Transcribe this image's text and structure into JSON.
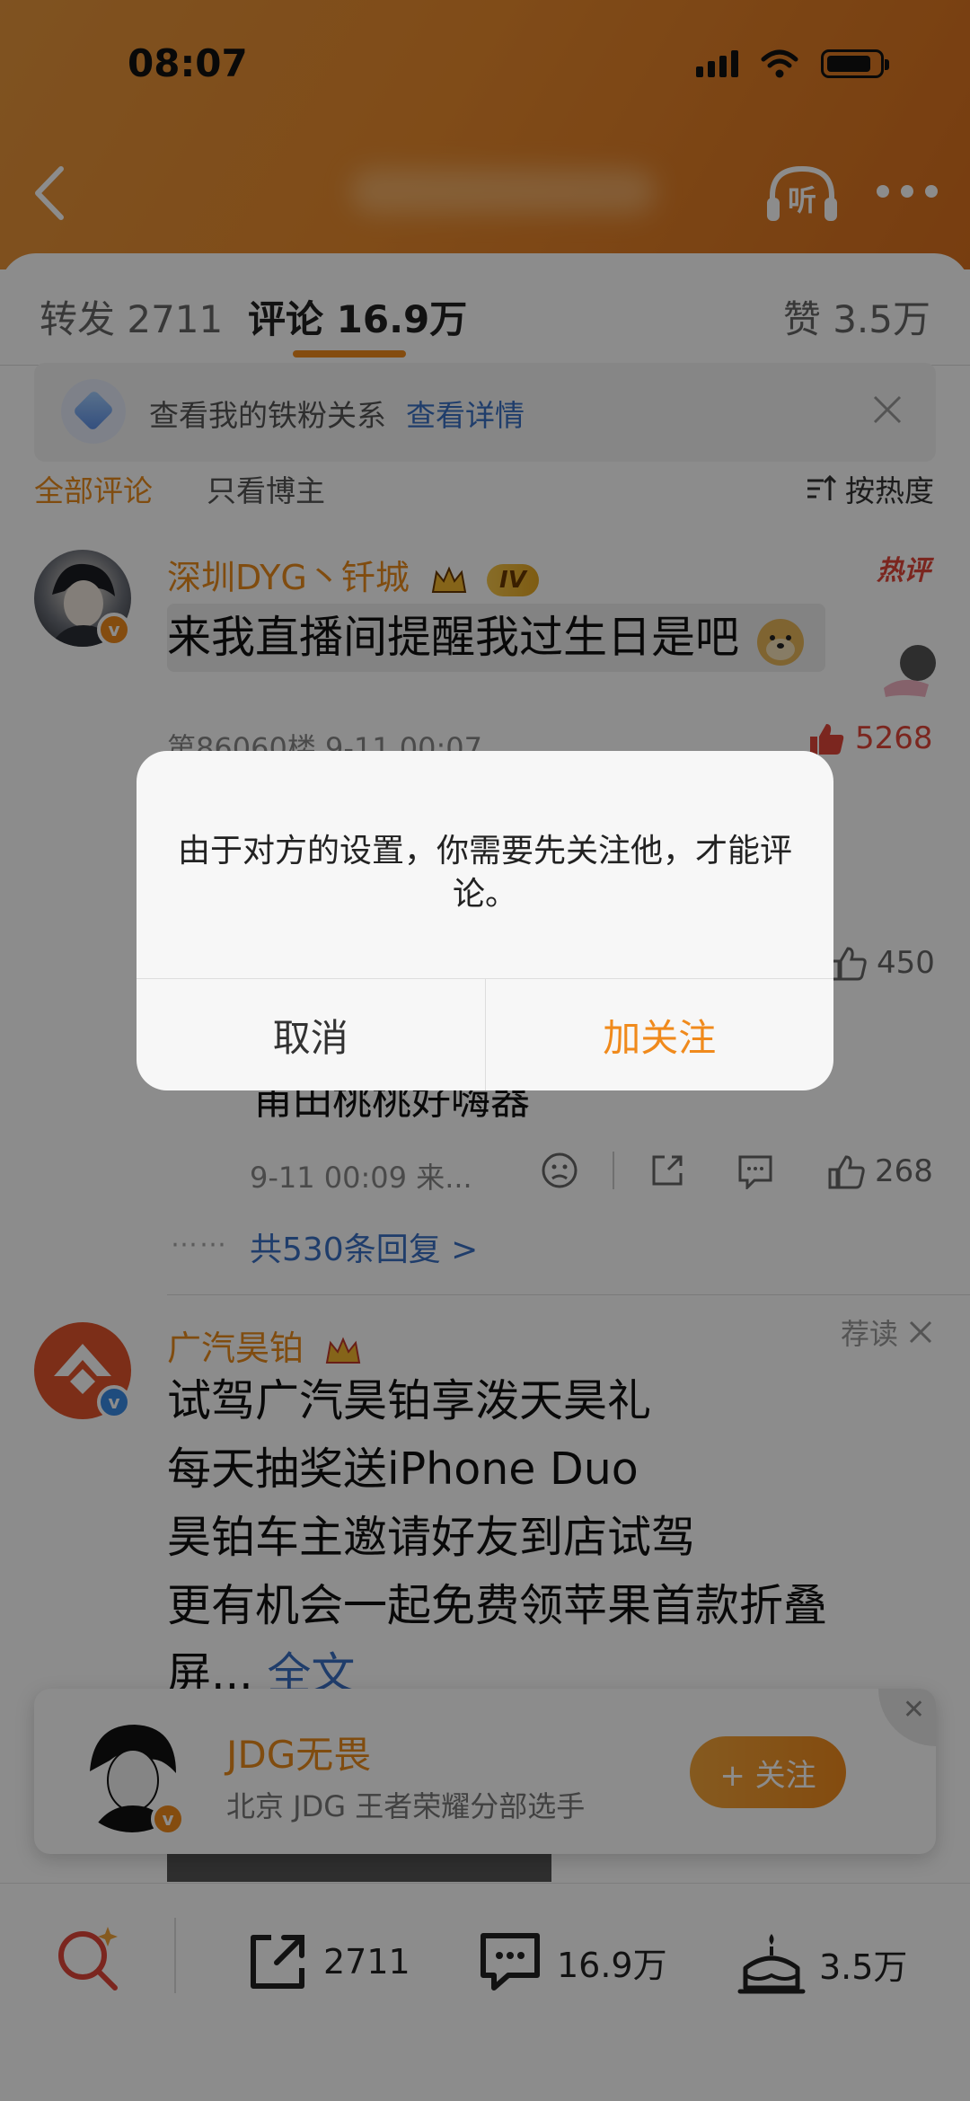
{
  "status_bar": {
    "time": "08:07"
  },
  "header": {
    "listen_label": "听"
  },
  "tabs": [
    {
      "label": "转发 2711"
    },
    {
      "label": "评论 16.9万"
    },
    {
      "label": "赞 3.5万"
    }
  ],
  "fans_bar": {
    "text": "查看我的铁粉关系",
    "link": "查看详情"
  },
  "filters": {
    "all": "全部评论",
    "host_only": "只看博主",
    "sort": "按热度"
  },
  "comments": [
    {
      "username": "深圳DYG丶钎城",
      "level": "IV",
      "hot_tag": "热评",
      "text": "来我直播间提醒我过生日是吧",
      "meta": "第86060楼 9-11 00:07",
      "likes": "5268"
    },
    {
      "likes": "450"
    },
    {
      "text": "甫田桃桃好嗨器",
      "meta": "9-11 00:09 来...",
      "likes": "268"
    }
  ],
  "replies": {
    "dots": "⋯⋯",
    "label": "共530条回复 >"
  },
  "ad": {
    "username": "广汽昊铂",
    "tag": "荐读",
    "lines": [
      "试驾广汽昊铂享泼天昊礼",
      "每天抽奖送iPhone Duo",
      "昊铂车主邀请好友到店试驾",
      "更有机会一起免费领苹果首款折叠"
    ],
    "last_line": "屏...",
    "more": "全文"
  },
  "follow_card": {
    "name": "JDG无畏",
    "description": "北京 JDG 王者荣耀分部选手",
    "button": "+ 关注"
  },
  "bottom_bar": {
    "reposts": "2711",
    "comments": "16.9万",
    "likes": "3.5万"
  },
  "dialog": {
    "message": "由于对方的设置，你需要先关注他，才能评论。",
    "cancel": "取消",
    "confirm": "加关注"
  },
  "colors": {
    "accent": "#f08a1c",
    "link": "#3a6fc4",
    "header": "#e98a2d"
  }
}
